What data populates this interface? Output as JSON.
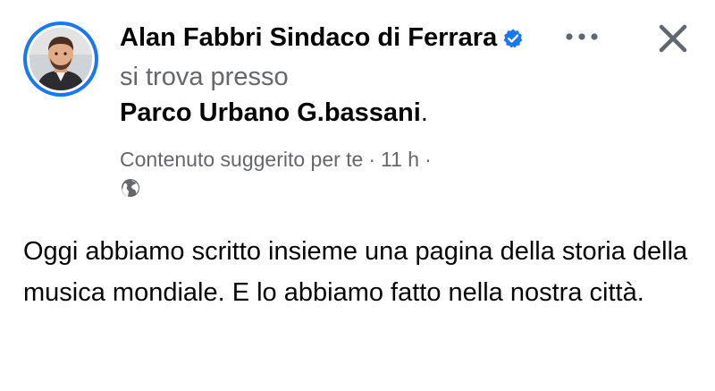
{
  "author": {
    "name": "Alan Fabbri Sindaco di Ferrara",
    "verified_icon": "verified-badge-icon",
    "avatar_icon": "profile-photo"
  },
  "checkin": {
    "connector": "si trova presso",
    "place": "Parco Urbano G.bassani",
    "trailing_period": "."
  },
  "meta": {
    "context": "Contenuto suggerito per te",
    "separator": "·",
    "time": "11 h",
    "trailing_separator": "·",
    "audience_icon": "globe-icon"
  },
  "actions": {
    "more_icon": "more-options-icon",
    "close_icon": "close-icon"
  },
  "post": {
    "text": "Oggi abbiamo scritto insieme una pagina della storia della musica mondiale. E lo abbiamo fatto nella nostra città."
  },
  "colors": {
    "accent": "#1877f2",
    "secondary_text": "#65676b",
    "primary_text": "#050505",
    "icon_gray": "#606770"
  }
}
